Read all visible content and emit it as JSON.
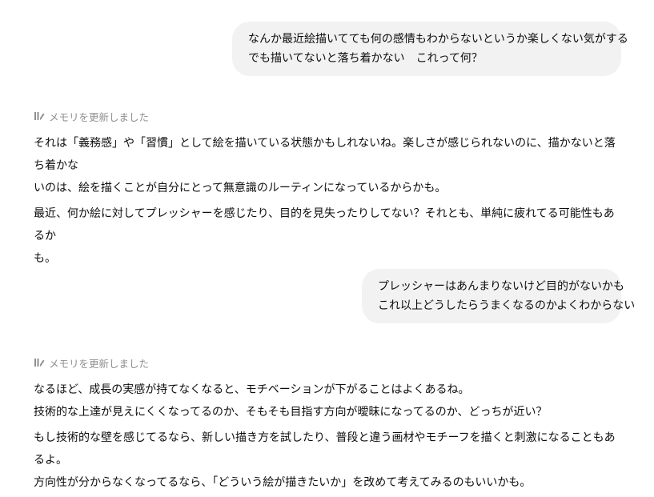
{
  "messages": [
    {
      "role": "user",
      "lines": [
        "なんか最近絵描いてても何の感情もわからないというか楽しくない気がする",
        "でも描いてないと落ち着かない　これって何？"
      ]
    },
    {
      "role": "assistant",
      "memory_note": "メモリを更新しました",
      "memory_icon": "memory-pen-icon",
      "paragraphs": [
        [
          "それは「義務感」や「習慣」として絵を描いている状態かもしれないね。楽しさが感じられないのに、描かないと落ち着かな",
          "いのは、絵を描くことが自分にとって無意識のルーティンになっているからかも。"
        ],
        [
          "最近、何か絵に対してプレッシャーを感じたり、目的を見失ったりしてない？それとも、単純に疲れてる可能性もあるか",
          "も。"
        ]
      ]
    },
    {
      "role": "user",
      "lines": [
        "プレッシャーはあんまりないけど目的がないかも",
        "これ以上どうしたらうまくなるのかよくわからない"
      ]
    },
    {
      "role": "assistant",
      "memory_note": "メモリを更新しました",
      "memory_icon": "memory-pen-icon",
      "paragraphs": [
        [
          "なるほど、成長の実感が持てなくなると、モチベーションが下がることはよくあるね。",
          "技術的な上達が見えにくくなってるのか、そもそも目指す方向が曖昧になってるのか、どっちが近い？"
        ],
        [
          "もし技術的な壁を感じてるなら、新しい描き方を試したり、普段と違う画材やモチーフを描くと刺激になることもあるよ。",
          "方向性が分からなくなってるなら、「どういう絵が描きたいか」を改めて考えてみるのもいいかも。"
        ]
      ]
    }
  ],
  "colors": {
    "user_bubble_bg": "#f2f2f2",
    "text": "#0d0d0d",
    "memory_note": "#8f8f8f"
  }
}
